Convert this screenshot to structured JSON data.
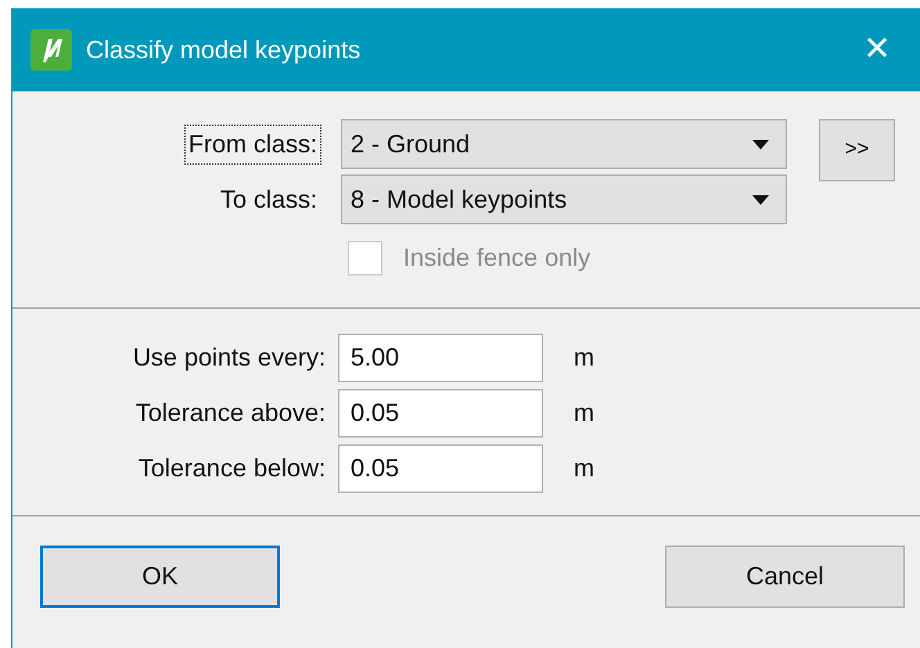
{
  "window": {
    "title": "Classify model keypoints",
    "close": "✕"
  },
  "classes": [
    {
      "label": "From class:",
      "value": "2 - Ground",
      "focused": true
    },
    {
      "label": "To class:",
      "value": "8 - Model keypoints",
      "focused": false
    }
  ],
  "more_button": ">>",
  "inside_fence": {
    "label": "Inside fence only",
    "checked": false,
    "disabled": true
  },
  "fields": [
    {
      "label": "Use points every:",
      "value": "5.00",
      "unit": "m"
    },
    {
      "label": "Tolerance above:",
      "value": "0.05",
      "unit": "m"
    },
    {
      "label": "Tolerance below:",
      "value": "0.05",
      "unit": "m"
    }
  ],
  "buttons": [
    {
      "label": "OK",
      "default": true
    },
    {
      "label": "Cancel",
      "default": false
    }
  ]
}
